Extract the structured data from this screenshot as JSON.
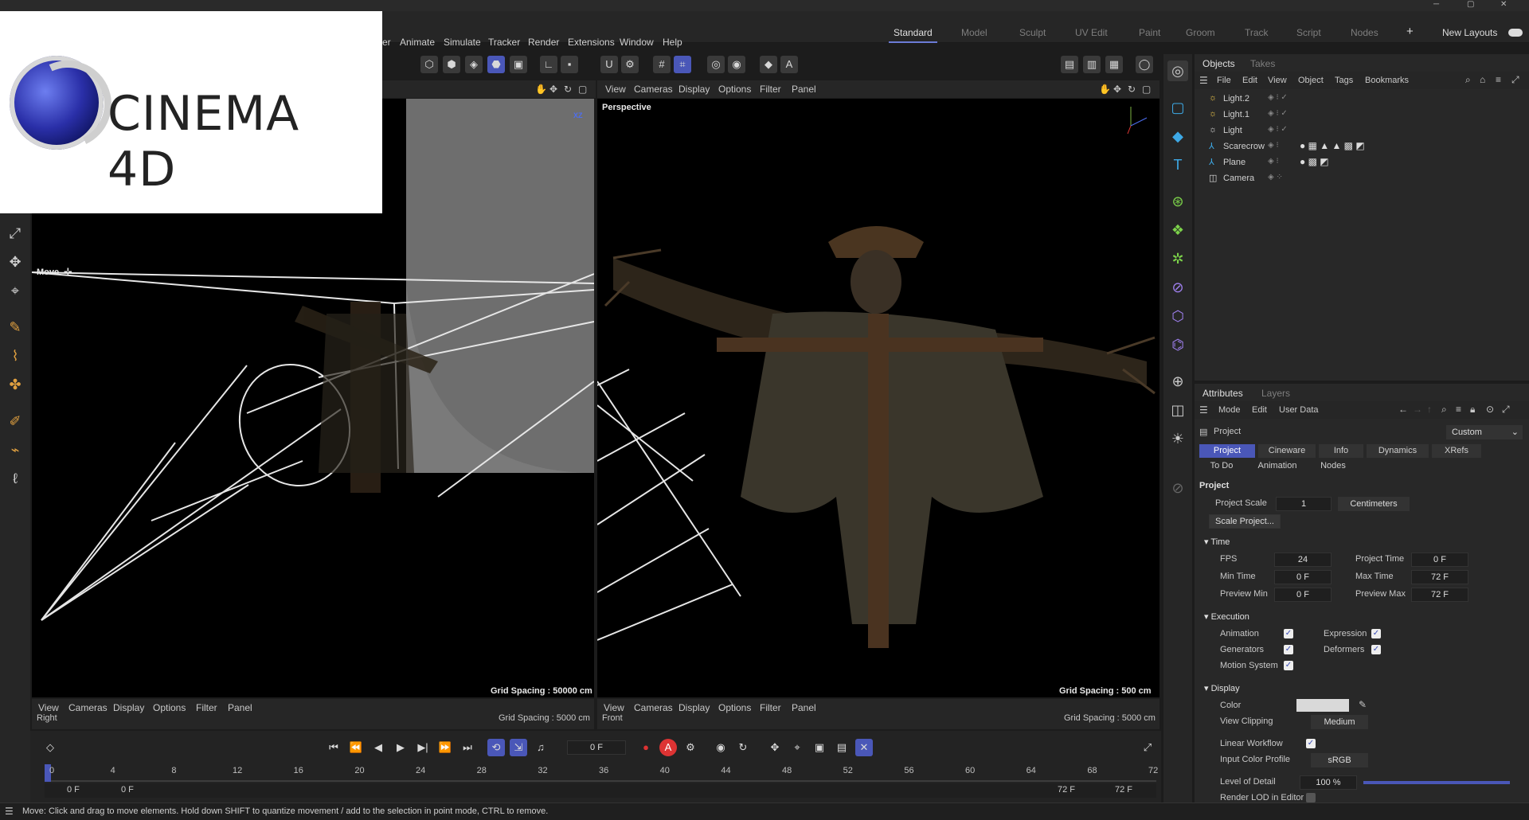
{
  "logo": {
    "text": "CINEMA 4D"
  },
  "menu": [
    "er",
    "Animate",
    "Simulate",
    "Tracker",
    "Render",
    "Extensions",
    "Window",
    "Help"
  ],
  "layouts": {
    "tabs": [
      "Standard",
      "Model",
      "Sculpt",
      "UV Edit",
      "Paint",
      "Groom",
      "Track",
      "Script",
      "Nodes"
    ],
    "new_layouts": "New Layouts"
  },
  "viewports": {
    "left": {
      "mode": "Move",
      "grid": "Grid Spacing : 50000 cm",
      "menu": [
        "View",
        "Cameras",
        "Display",
        "Options",
        "Filter",
        "Panel"
      ],
      "axis": "XZ"
    },
    "right": {
      "name": "Perspective",
      "grid": "Grid Spacing : 500 cm",
      "menu": [
        "View",
        "Cameras",
        "Display",
        "Options",
        "Filter",
        "Panel"
      ]
    },
    "bottom_left": {
      "name": "Right",
      "grid": "Grid Spacing : 5000 cm",
      "menu": [
        "View",
        "Cameras",
        "Display",
        "Options",
        "Filter",
        "Panel"
      ]
    },
    "bottom_right": {
      "name": "Front",
      "grid": "Grid Spacing : 5000 cm",
      "menu": [
        "View",
        "Cameras",
        "Display",
        "Options",
        "Filter",
        "Panel"
      ]
    }
  },
  "objects": {
    "tabs": [
      "Objects",
      "Takes"
    ],
    "menu": [
      "File",
      "Edit",
      "View",
      "Object",
      "Tags",
      "Bookmarks"
    ],
    "items": [
      {
        "name": "Light.2",
        "icon": "light-icon"
      },
      {
        "name": "Light.1",
        "icon": "light-icon"
      },
      {
        "name": "Light",
        "icon": "light-icon"
      },
      {
        "name": "Scarecrow",
        "icon": "mesh-icon"
      },
      {
        "name": "Plane",
        "icon": "mesh-icon"
      },
      {
        "name": "Camera",
        "icon": "camera-icon"
      }
    ]
  },
  "attributes": {
    "tabs": [
      "Attributes",
      "Layers"
    ],
    "menu": [
      "Mode",
      "Edit",
      "User Data"
    ],
    "object_name": "Project",
    "preset": "Custom",
    "sub_tabs_row1": [
      "Project",
      "Cineware",
      "Info",
      "Dynamics",
      "XRefs"
    ],
    "sub_tabs_row2": [
      "To Do",
      "Animation",
      "Nodes"
    ],
    "section_title": "Project",
    "project_scale_label": "Project Scale",
    "project_scale_value": "1",
    "project_scale_unit": "Centimeters",
    "scale_button": "Scale Project...",
    "time": {
      "title": "Time",
      "fps_label": "FPS",
      "fps": "24",
      "project_time_label": "Project Time",
      "project_time": "0 F",
      "min_time_label": "Min Time",
      "min_time": "0 F",
      "max_time_label": "Max Time",
      "max_time": "72 F",
      "preview_min_label": "Preview Min",
      "preview_min": "0 F",
      "preview_max_label": "Preview Max",
      "preview_max": "72 F"
    },
    "execution": {
      "title": "Execution",
      "animation": "Animation",
      "expression": "Expression",
      "generators": "Generators",
      "deformers": "Deformers",
      "motion_system": "Motion System"
    },
    "display": {
      "title": "Display",
      "color_label": "Color",
      "color_value": "#d9d9d9",
      "view_clipping_label": "View Clipping",
      "view_clipping": "Medium",
      "linear_workflow": "Linear Workflow",
      "input_color_profile_label": "Input Color Profile",
      "input_color_profile": "sRGB",
      "level_of_detail_label": "Level of Detail",
      "level_of_detail": "100 %",
      "render_lod_label": "Render LOD in Editor"
    }
  },
  "timeline": {
    "current_frame": "0 F",
    "ruler": [
      "0",
      "4",
      "8",
      "12",
      "16",
      "20",
      "24",
      "28",
      "32",
      "36",
      "40",
      "44",
      "48",
      "52",
      "56",
      "60",
      "64",
      "68",
      "72"
    ],
    "start": "0 F",
    "start2": "0 F",
    "end": "72 F",
    "end2": "72 F"
  },
  "status": {
    "message": "Move: Click and drag to move elements. Hold down SHIFT to quantize movement / add to the selection in point mode, CTRL to remove."
  },
  "colors": {
    "accent": "#4a57b8",
    "background": "#1c1c1c",
    "panel": "#282828"
  }
}
